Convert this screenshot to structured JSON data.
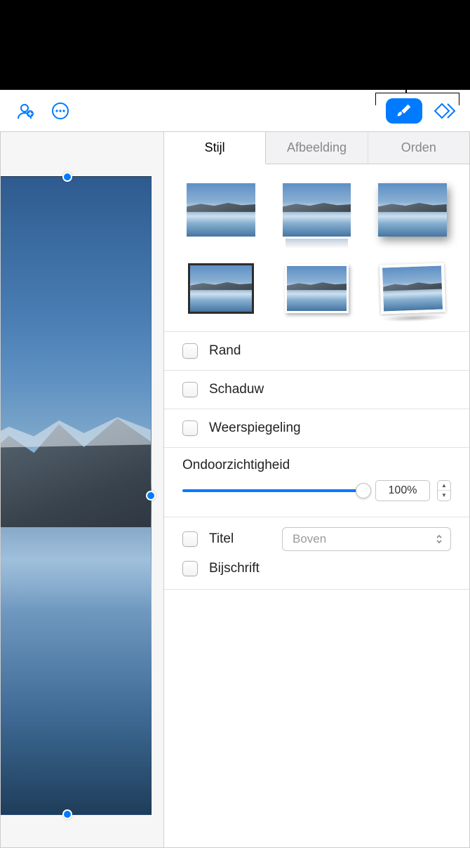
{
  "toolbar": {
    "collaborate_icon": "collaborate",
    "more_icon": "more",
    "format_icon": "format",
    "shape_icon": "shape"
  },
  "tabs": {
    "style": "Stijl",
    "image": "Afbeelding",
    "arrange": "Orden"
  },
  "style_presets": [
    "plain",
    "reflect",
    "shadow",
    "border",
    "frame",
    "frame-curl"
  ],
  "checks": {
    "border": "Rand",
    "shadow": "Schaduw",
    "reflection": "Weerspiegeling"
  },
  "opacity": {
    "label": "Ondoorzichtigheid",
    "value": "100%"
  },
  "title": {
    "label": "Titel",
    "dropdown_value": "Boven"
  },
  "caption": {
    "label": "Bijschrift"
  }
}
